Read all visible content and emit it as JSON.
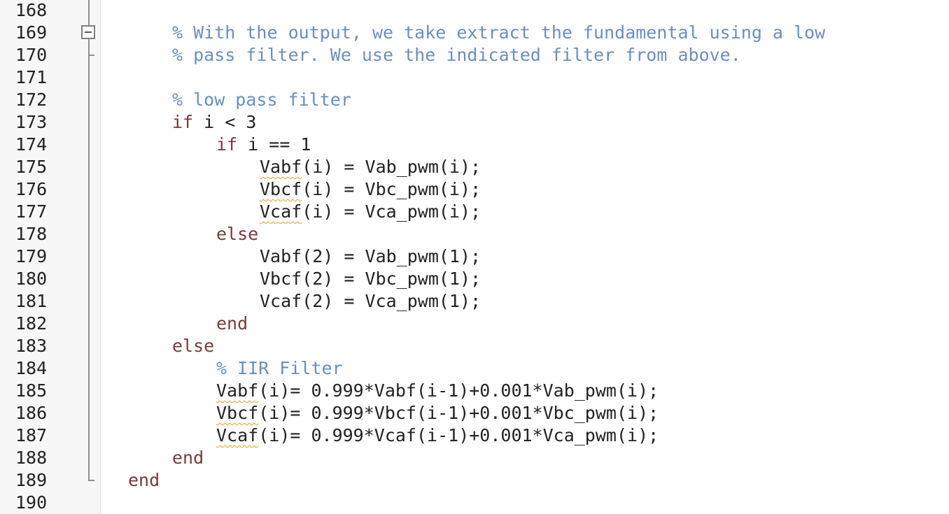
{
  "editor": {
    "line_numbers": [
      "168",
      "169",
      "170",
      "171",
      "172",
      "173",
      "174",
      "175",
      "176",
      "177",
      "178",
      "179",
      "180",
      "181",
      "182",
      "183",
      "184",
      "185",
      "186",
      "187",
      "188",
      "189",
      "190"
    ],
    "lines": {
      "l169": "% With the output, we take extract the fundamental using a low",
      "l170": "% pass filter. We use the indicated filter from above.",
      "l172": "% low pass filter",
      "l173_kw": "if",
      "l173_rest": " i < 3",
      "l174_kw": "if",
      "l174_rest": " i == 1",
      "l175_var": "Vabf",
      "l175_rest": "(i) = Vab_pwm(i);",
      "l176_var": "Vbcf",
      "l176_rest": "(i) = Vbc_pwm(i);",
      "l177_var": "Vcaf",
      "l177_rest": "(i) = Vca_pwm(i);",
      "l178_kw": "else",
      "l179": "Vabf(2) = Vab_pwm(1);",
      "l180": "Vbcf(2) = Vbc_pwm(1);",
      "l181": "Vcaf(2) = Vca_pwm(1);",
      "l182_kw": "end",
      "l183_kw": "else",
      "l184": "% IIR Filter",
      "l185_var": "Vabf",
      "l185_rest": "(i)= 0.999*Vabf(i-1)+0.001*Vab_pwm(i);",
      "l186_var": "Vbcf",
      "l186_rest": "(i)= 0.999*Vbcf(i-1)+0.001*Vbc_pwm(i);",
      "l187_var": "Vcaf",
      "l187_rest": "(i)= 0.999*Vcaf(i-1)+0.001*Vca_pwm(i);",
      "l188_kw": "end",
      "l189_kw": "end"
    },
    "colors": {
      "comment": "#6a8fc0",
      "keyword": "#7b3a3a",
      "text": "#222222",
      "warning_underline": "#e0a21e"
    }
  }
}
